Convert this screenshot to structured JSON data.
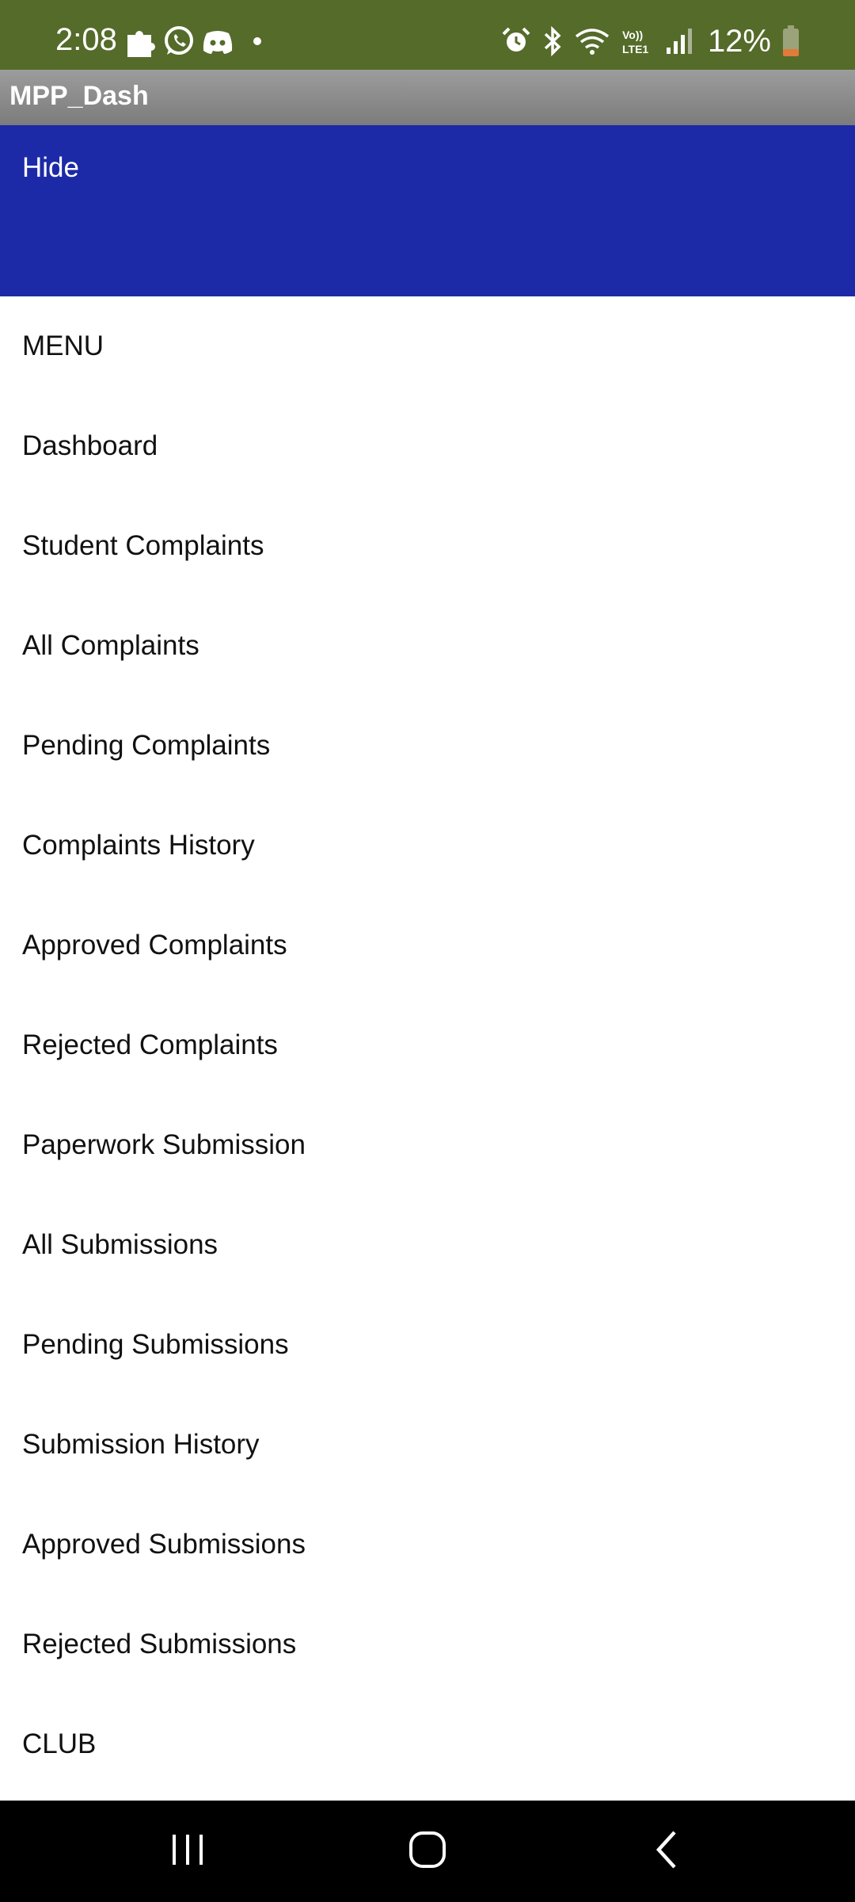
{
  "status_bar": {
    "time": "2:08",
    "battery": "12%",
    "left_icons": [
      "puzzle-icon",
      "whatsapp-icon",
      "discord-icon",
      "dot-icon"
    ],
    "right_icons": [
      "alarm-icon",
      "bluetooth-icon",
      "wifi-icon",
      "volte-icon",
      "signal-icon",
      "battery-icon"
    ],
    "volte_text": "Vo)) LTE1",
    "battery_color": "#e07b3a"
  },
  "app": {
    "title": "MPP_Dash"
  },
  "header": {
    "hide_label": "Hide",
    "color": "#1c2aa8"
  },
  "menu": {
    "items": [
      {
        "label": "MENU"
      },
      {
        "label": "Dashboard"
      },
      {
        "label": "Student Complaints"
      },
      {
        "label": "All Complaints"
      },
      {
        "label": "Pending Complaints"
      },
      {
        "label": "Complaints History"
      },
      {
        "label": "Approved Complaints"
      },
      {
        "label": "Rejected Complaints"
      },
      {
        "label": "Paperwork Submission"
      },
      {
        "label": "All Submissions"
      },
      {
        "label": "Pending Submissions"
      },
      {
        "label": "Submission History"
      },
      {
        "label": "Approved Submissions"
      },
      {
        "label": "Rejected Submissions"
      },
      {
        "label": "CLUB"
      }
    ]
  },
  "nav_bar": {
    "buttons": [
      "recents-icon",
      "home-icon",
      "back-icon"
    ]
  }
}
